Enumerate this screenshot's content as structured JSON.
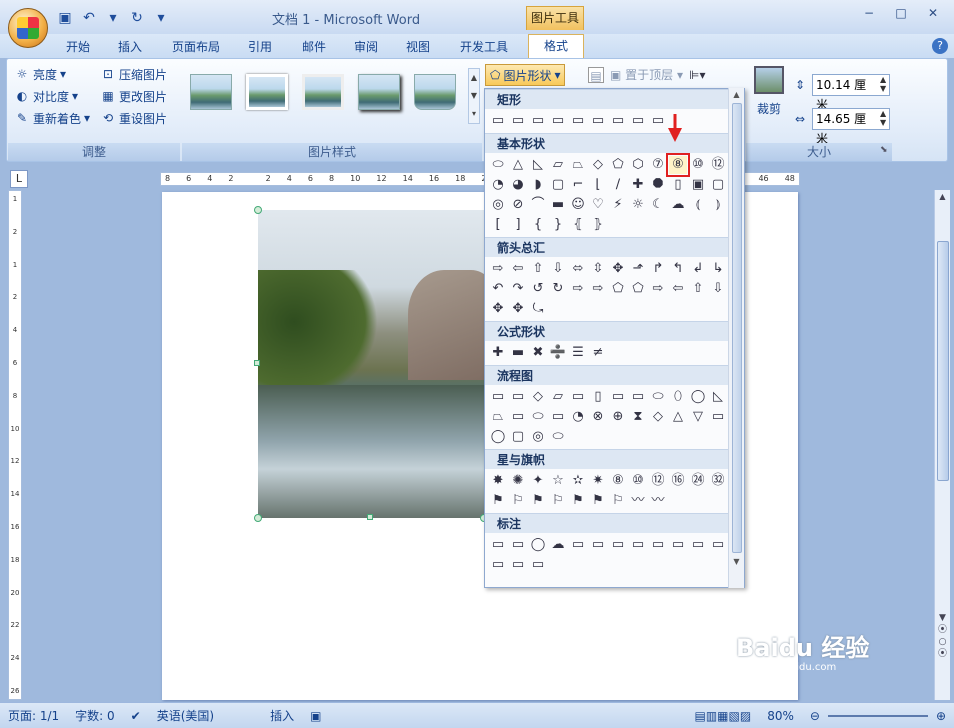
{
  "window": {
    "title": "文档 1 - Microsoft Word",
    "context_tab": "图片工具"
  },
  "tabs": [
    "开始",
    "插入",
    "页面布局",
    "引用",
    "邮件",
    "审阅",
    "视图",
    "开发工具"
  ],
  "active_tab": "格式",
  "adjust": {
    "brightness": "亮度",
    "contrast": "对比度",
    "recolor": "重新着色",
    "compress": "压缩图片",
    "change": "更改图片",
    "reset": "重设图片",
    "label": "调整"
  },
  "picstyles": {
    "label": "图片样式"
  },
  "shape_button": "图片形状",
  "bring_front": "置于顶层",
  "crop": "裁剪",
  "size": {
    "height": "10.14 厘米",
    "width": "14.65 厘米",
    "label": "大小"
  },
  "ruler": {
    "ticks": [
      "8",
      "6",
      "4",
      "2",
      "",
      "2",
      "4",
      "6",
      "8",
      "10",
      "12",
      "14",
      "16",
      "18",
      "20",
      "",
      "",
      "",
      "",
      "",
      "",
      "",
      "",
      "",
      "",
      "",
      "",
      "",
      "",
      "44",
      "46",
      "48"
    ]
  },
  "vruler": [
    "1",
    "2",
    "1",
    "2",
    "4",
    "6",
    "8",
    "10",
    "12",
    "14",
    "16",
    "18",
    "20",
    "22",
    "24",
    "26"
  ],
  "menu": {
    "sections": [
      {
        "title": "矩形",
        "shapes": [
          "▭",
          "▭",
          "▭",
          "▭",
          "▭",
          "▭",
          "▭",
          "▭",
          "▭"
        ]
      },
      {
        "title": "基本形状",
        "shapes": [
          "⬭",
          "△",
          "◺",
          "▱",
          "⏢",
          "◇",
          "⬠",
          "⬡",
          "⑦",
          "⑧",
          "⑩",
          "⑫",
          "◔",
          "◕",
          "◗",
          "▢",
          "⌐",
          "⌊",
          "∕",
          "✚",
          "⯃",
          "▯",
          "▣",
          "▢",
          "◎",
          "⊘",
          "⌒",
          "▬",
          "☺",
          "♡",
          "⚡",
          "☼",
          "☾",
          "☁",
          "⦅",
          "⦆",
          "[",
          "]",
          "{",
          "}",
          "⦃",
          "⦄"
        ]
      },
      {
        "title": "箭头总汇",
        "shapes": [
          "⇨",
          "⇦",
          "⇧",
          "⇩",
          "⬄",
          "⇳",
          "✥",
          "⬏",
          "↱",
          "↰",
          "↲",
          "↳",
          "↶",
          "↷",
          "↺",
          "↻",
          "⇨",
          "⇨",
          "⬠",
          "⬠",
          "⇨",
          "⇦",
          "⇧",
          "⇩",
          "✥",
          "✥",
          "⤿"
        ]
      },
      {
        "title": "公式形状",
        "shapes": [
          "✚",
          "▬",
          "✖",
          "➗",
          "☰",
          "≠"
        ]
      },
      {
        "title": "流程图",
        "shapes": [
          "▭",
          "▭",
          "◇",
          "▱",
          "▭",
          "▯",
          "▭",
          "▭",
          "⬭",
          "⬯",
          "◯",
          "◺",
          "⏢",
          "▭",
          "⬭",
          "▭",
          "◔",
          "⊗",
          "⊕",
          "⧗",
          "◇",
          "△",
          "▽",
          "▭",
          "◯",
          "▢",
          "◎",
          "⬭"
        ]
      },
      {
        "title": "星与旗帜",
        "shapes": [
          "✸",
          "✺",
          "✦",
          "☆",
          "✫",
          "✷",
          "⑧",
          "⑩",
          "⑫",
          "⑯",
          "㉔",
          "㉜",
          "⚑",
          "⚐",
          "⚑",
          "⚐",
          "⚑",
          "⚑",
          "⚐",
          "〰",
          "〰"
        ]
      },
      {
        "title": "标注",
        "shapes": [
          "▭",
          "▭",
          "◯",
          "☁",
          "▭",
          "▭",
          "▭",
          "▭",
          "▭",
          "▭",
          "▭",
          "▭",
          "▭",
          "▭",
          "▭"
        ]
      }
    ],
    "selected": "⑧"
  },
  "status": {
    "page": "页面: 1/1",
    "words": "字数: 0",
    "lang": "英语(美国)",
    "mode": "插入",
    "zoom": "80%"
  },
  "watermark": {
    "text": "Baidu 经验",
    "url": "jingyan.baidu.com"
  }
}
